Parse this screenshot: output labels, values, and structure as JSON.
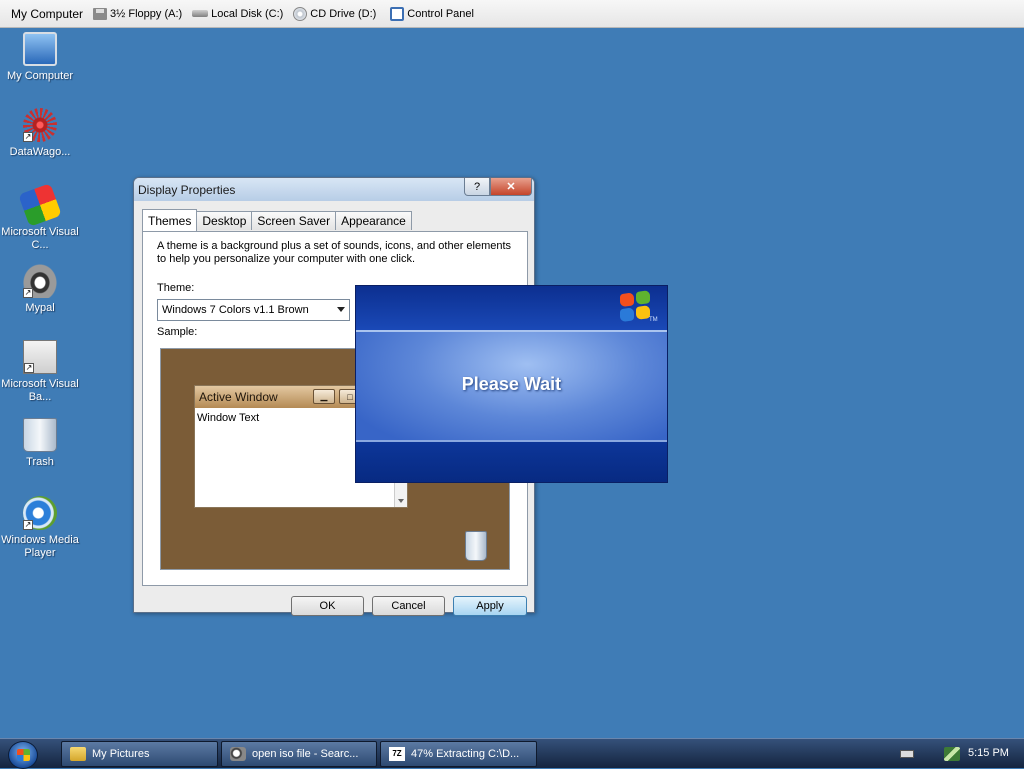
{
  "topbar": {
    "items": [
      {
        "label": "My Computer",
        "icon": "computer-icon"
      },
      {
        "label": "3½ Floppy (A:)",
        "icon": "floppy-icon"
      },
      {
        "label": "Local Disk (C:)",
        "icon": "hard-disk-icon"
      },
      {
        "label": "CD Drive (D:)",
        "icon": "cd-drive-icon"
      },
      {
        "label": "Control Panel",
        "icon": "control-panel-icon"
      }
    ]
  },
  "desktop": {
    "icons": [
      {
        "label": "My Computer",
        "icon": "my-computer-icon"
      },
      {
        "label": "DataWago...",
        "icon": "datawagon-icon"
      },
      {
        "label": "Microsoft Visual C...",
        "icon": "visual-c-icon"
      },
      {
        "label": "Mypal",
        "icon": "mypal-icon"
      },
      {
        "label": "Microsoft Visual Ba...",
        "icon": "visual-basic-icon"
      },
      {
        "label": "Trash",
        "icon": "trash-icon"
      },
      {
        "label": "Windows Media Player",
        "icon": "media-player-icon"
      }
    ]
  },
  "display_properties": {
    "title": "Display Properties",
    "help_glyph": "?",
    "close_glyph": "✕",
    "tabs": [
      "Themes",
      "Desktop",
      "Screen Saver",
      "Appearance"
    ],
    "active_tab": "Themes",
    "description": "A theme is a background plus a set of sounds, icons, and other elements to help you personalize your computer with one click.",
    "theme_label": "Theme:",
    "theme_value": "Windows 7 Colors v1.1 Brown",
    "sample_label": "Sample:",
    "sample": {
      "window_title": "Active Window",
      "window_text": "Window Text"
    },
    "buttons": {
      "ok": "OK",
      "cancel": "Cancel",
      "apply": "Apply"
    }
  },
  "splash": {
    "text": "Please Wait",
    "trademark": "TM"
  },
  "taskbar": {
    "tasks": [
      {
        "label": "My Pictures",
        "icon": "folder-icon"
      },
      {
        "label": "open iso file - Searc...",
        "icon": "search-icon"
      },
      {
        "label": "47% Extracting C:\\D...",
        "icon": "7zip-icon"
      }
    ],
    "seven_zip_glyph": "7Z",
    "clock": "5:15 PM"
  },
  "colors": {
    "desktop": "#3f7cb6",
    "sample_background": "#7b5c37",
    "splash_blue": "#0d3499"
  }
}
